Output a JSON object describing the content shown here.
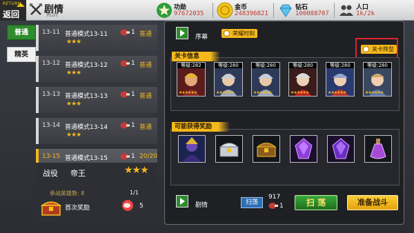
{
  "topbar": {
    "return_en": "RETURN",
    "return_cn": "返回",
    "title": "剧情",
    "subtitle": "PLOT",
    "resources": [
      {
        "label": "功勋",
        "value": "97672035",
        "icon": "star-icon",
        "color": "#2e9d3a"
      },
      {
        "label": "金币",
        "value": "248396821",
        "icon": "coin-icon",
        "color": "#f2c31a"
      },
      {
        "label": "钻石",
        "value": "100088707",
        "icon": "diamond-icon",
        "color": "#5ec5ef"
      },
      {
        "label": "人口",
        "value": "1k/2k",
        "icon": "people-icon",
        "color": "#444444"
      }
    ]
  },
  "side_tabs": {
    "normal": "普通",
    "elite": "精英"
  },
  "stages": [
    {
      "no": "13-11",
      "name": "普通模式13-11",
      "stars": "★★★",
      "cost": "1",
      "mode": "普通",
      "active": false
    },
    {
      "no": "13-12",
      "name": "普通模式13-12",
      "stars": "★★★",
      "cost": "1",
      "mode": "普通",
      "active": false
    },
    {
      "no": "13-13",
      "name": "普通模式13-13",
      "stars": "★★★",
      "cost": "1",
      "mode": "普通",
      "active": false
    },
    {
      "no": "13-14",
      "name": "普通模式13-14",
      "stars": "★★★",
      "cost": "1",
      "mode": "普通",
      "active": false
    },
    {
      "no": "13-15",
      "name": "普通模式13-15",
      "stars": "★★★",
      "cost": "1",
      "mode": "20/20",
      "active": true
    }
  ],
  "info": {
    "label": "战役",
    "boss": "帝王",
    "stars": "★★★",
    "hero_count": "参战英雄数: 8",
    "ratio": "1/1",
    "first_reward": "首次奖励",
    "reward_count": "5"
  },
  "main": {
    "prologue": "序幕",
    "honor": "荣耀时刻",
    "lineup": "关卡阵型",
    "stage_info": "关卡信息",
    "possible_rewards": "可能获得奖励",
    "story": "剧情",
    "sweep_small": "扫荡",
    "sweep_count": "917",
    "sweep_cost": "1",
    "sweep_btn": "扫 荡",
    "battle_btn": "准备战斗"
  },
  "enemies": [
    {
      "hp": "等级:282",
      "stars": "★★★★★★"
    },
    {
      "hp": "等级:280",
      "stars": "★★★★★★"
    },
    {
      "hp": "等级:280",
      "stars": "★★★★★★"
    },
    {
      "hp": "等级:280",
      "stars": "★★★★★★"
    },
    {
      "hp": "等级:280",
      "stars": "★★★★★★"
    },
    {
      "hp": "等级:280",
      "stars": "★★★★★★"
    }
  ],
  "rewards": [
    {
      "icon": "hero-portrait-icon"
    },
    {
      "icon": "silver-chest-icon"
    },
    {
      "icon": "gold-chest-icon"
    },
    {
      "icon": "purple-gem-icon"
    },
    {
      "icon": "purple-gem-icon"
    },
    {
      "icon": "potion-icon"
    }
  ]
}
